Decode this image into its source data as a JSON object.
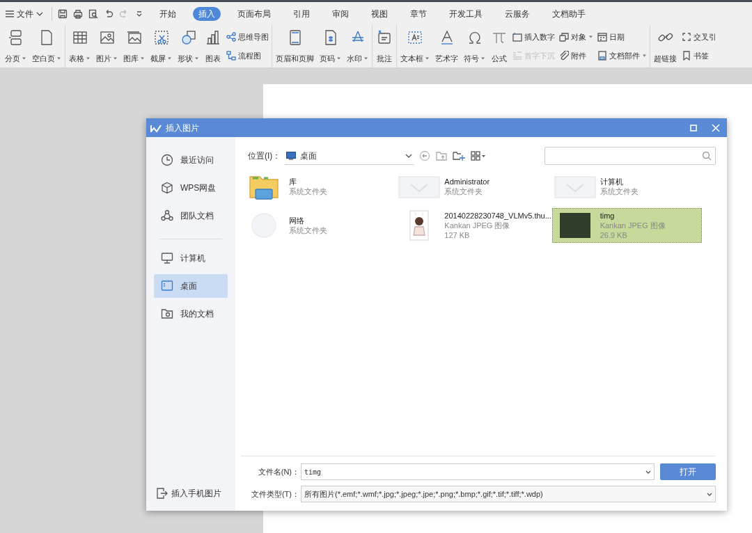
{
  "menu_bar": {
    "file_menu": "文件",
    "tabs": [
      {
        "label": "开始",
        "selected": false
      },
      {
        "label": "插入",
        "selected": true
      },
      {
        "label": "页面布局",
        "selected": false
      },
      {
        "label": "引用",
        "selected": false
      },
      {
        "label": "审阅",
        "selected": false
      },
      {
        "label": "视图",
        "selected": false
      },
      {
        "label": "章节",
        "selected": false
      },
      {
        "label": "开发工具",
        "selected": false
      },
      {
        "label": "云服务",
        "selected": false
      },
      {
        "label": "文档助手",
        "selected": false
      }
    ]
  },
  "ribbon": {
    "groups": [
      {
        "items": [
          {
            "kind": "big",
            "label": "分页",
            "caret": true
          },
          {
            "kind": "big",
            "label": "空白页",
            "caret": true
          }
        ]
      },
      {
        "items": [
          {
            "kind": "big",
            "label": "表格",
            "caret": true
          },
          {
            "kind": "big",
            "label": "图片",
            "caret": true
          },
          {
            "kind": "big",
            "label": "图库",
            "caret": true
          },
          {
            "kind": "big",
            "label": "截屏",
            "caret": true
          },
          {
            "kind": "big",
            "label": "形状",
            "caret": true
          },
          {
            "kind": "big",
            "label": "图表",
            "caret": false
          },
          {
            "kind": "stack",
            "items": [
              {
                "label": "思维导图",
                "caret": false,
                "disabled": false
              },
              {
                "label": "流程图",
                "caret": false,
                "disabled": false
              }
            ]
          }
        ]
      },
      {
        "items": [
          {
            "kind": "big",
            "label": "页眉和页脚",
            "caret": false
          },
          {
            "kind": "big",
            "label": "页码",
            "caret": true
          },
          {
            "kind": "big",
            "label": "水印",
            "caret": true
          }
        ]
      },
      {
        "items": [
          {
            "kind": "big",
            "label": "批注",
            "caret": false
          }
        ]
      },
      {
        "items": [
          {
            "kind": "big",
            "label": "文本框",
            "caret": true
          },
          {
            "kind": "big",
            "label": "艺术字",
            "caret": false
          },
          {
            "kind": "big",
            "label": "符号",
            "caret": true
          },
          {
            "kind": "big",
            "label": "公式",
            "caret": false
          },
          {
            "kind": "stack",
            "items": [
              {
                "label": "插入数字",
                "caret": false,
                "disabled": false
              },
              {
                "label": "首字下沉",
                "caret": false,
                "disabled": true
              }
            ]
          },
          {
            "kind": "stack",
            "items": [
              {
                "label": "对象",
                "caret": true,
                "disabled": false
              },
              {
                "label": "附件",
                "caret": false,
                "disabled": false
              }
            ]
          },
          {
            "kind": "stack",
            "items": [
              {
                "label": "日期",
                "caret": false,
                "disabled": false
              },
              {
                "label": "文档部件",
                "caret": true,
                "disabled": false
              }
            ]
          }
        ]
      },
      {
        "items": [
          {
            "kind": "big",
            "label": "超链接",
            "caret": false
          },
          {
            "kind": "stack",
            "items": [
              {
                "label": "交叉引",
                "caret": false,
                "disabled": false
              },
              {
                "label": "书签",
                "caret": false,
                "disabled": false
              }
            ]
          }
        ]
      }
    ]
  },
  "dialog": {
    "title": "插入图片",
    "sidebar": {
      "groups": [
        [
          {
            "label": "最近访问",
            "selected": false
          },
          {
            "label": "WPS网盘",
            "selected": false
          },
          {
            "label": "团队文档",
            "selected": false
          }
        ],
        [
          {
            "label": "计算机",
            "selected": false
          },
          {
            "label": "桌面",
            "selected": true
          },
          {
            "label": "我的文档",
            "selected": false
          }
        ]
      ],
      "footer": "插入手机图片"
    },
    "location": {
      "label": "位置(I)：",
      "value": "桌面"
    },
    "files": [
      {
        "kind": "library",
        "name": "库",
        "type": "系统文件夹",
        "selected": false
      },
      {
        "kind": "folder",
        "name": "Administrator",
        "type": "系统文件夹",
        "selected": false
      },
      {
        "kind": "folder",
        "name": "计算机",
        "type": "系统文件夹",
        "selected": false
      },
      {
        "kind": "network",
        "name": "网络",
        "type": "系统文件夹",
        "selected": false
      },
      {
        "kind": "image",
        "name": "20140228230748_VLMv5.thu...",
        "type": "Kankan JPEG 图像",
        "size": "127 KB",
        "selected": false
      },
      {
        "kind": "photo",
        "name": "timg",
        "type": "Kankan JPEG 图像",
        "size": "26.9 KB",
        "selected": true
      }
    ],
    "file_name": {
      "label": "文件名(N)：",
      "value": "timg"
    },
    "file_type": {
      "label": "文件类型(T)：",
      "value": "所有图片(*.emf;*.wmf;*.jpg;*.jpeg;*.jpe;*.png;*.bmp;*.gif;*.tif;*.tiff;*.wdp)"
    },
    "open_button": "打开"
  }
}
